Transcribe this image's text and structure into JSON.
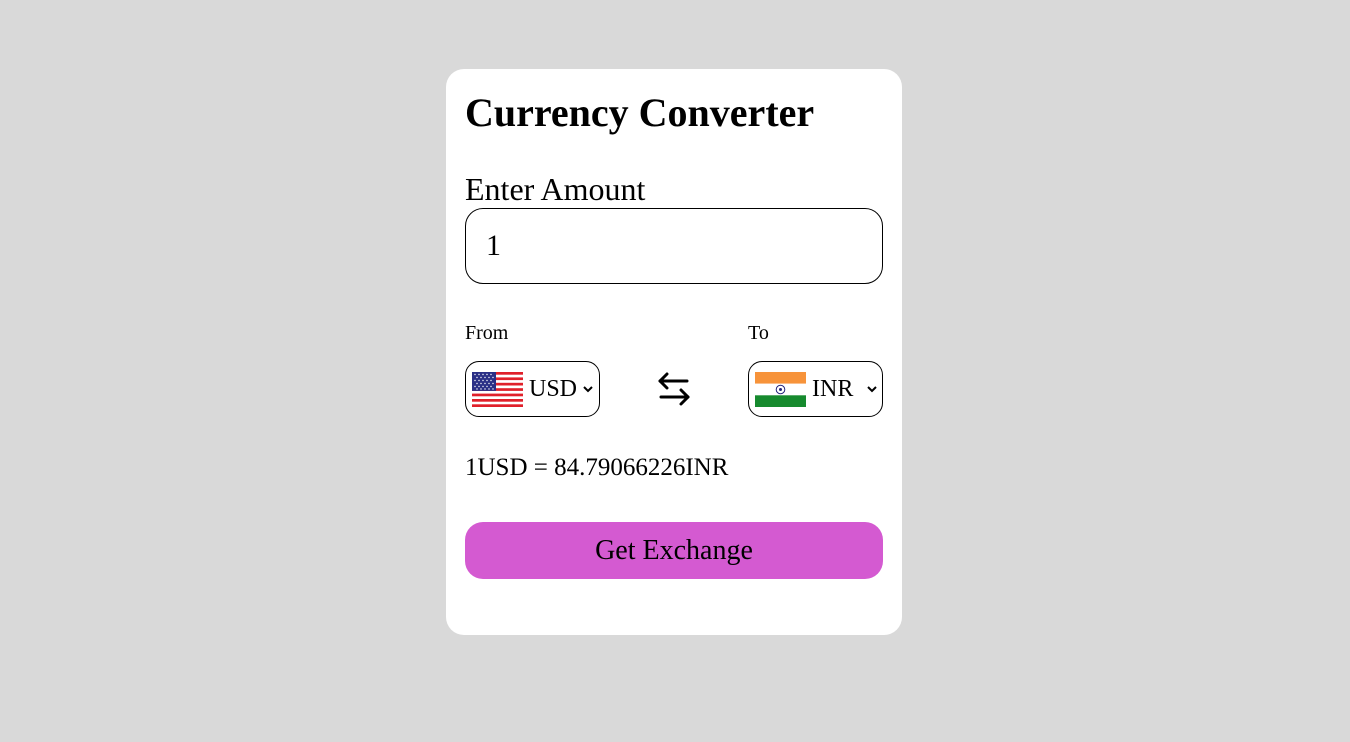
{
  "app": {
    "title": "Currency Converter"
  },
  "amount": {
    "label": "Enter Amount",
    "value": "1"
  },
  "from": {
    "label": "From",
    "currency": "USD",
    "flag": "us-flag-icon"
  },
  "to": {
    "label": "To",
    "currency": "INR",
    "flag": "india-flag-icon"
  },
  "swap": {
    "icon": "swap-arrows-icon"
  },
  "result": {
    "text": "1USD = 84.79066226INR"
  },
  "button": {
    "label": "Get Exchange"
  },
  "colors": {
    "background": "#d9d9d9",
    "card": "#ffffff",
    "button": "#d45ad1"
  }
}
